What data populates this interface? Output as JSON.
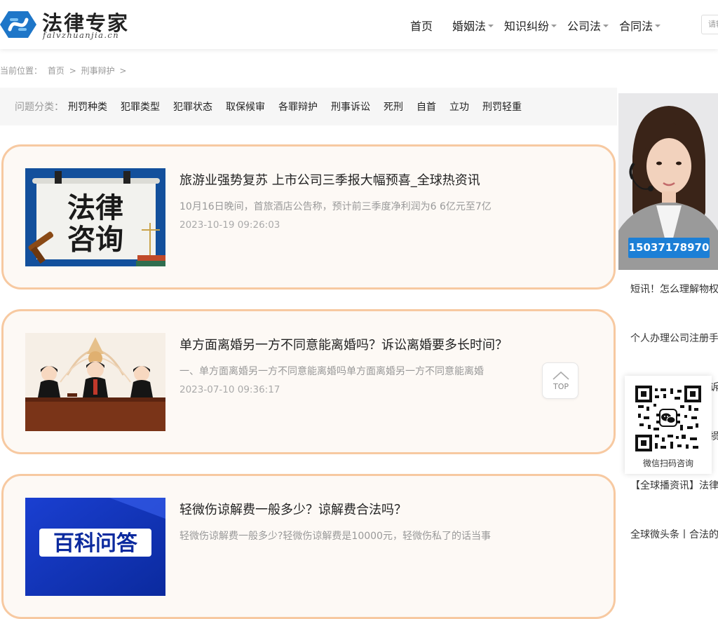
{
  "header": {
    "logo_title": "法律专家",
    "logo_sub": "falvzhuanjia.cn",
    "nav": [
      {
        "label": "首页",
        "has_dropdown": false
      },
      {
        "label": "婚姻法",
        "has_dropdown": true
      },
      {
        "label": "知识纠纷",
        "has_dropdown": true
      },
      {
        "label": "公司法",
        "has_dropdown": true
      },
      {
        "label": "合同法",
        "has_dropdown": true
      }
    ],
    "search_placeholder": "请输"
  },
  "breadcrumb": {
    "prefix": "当前位置：",
    "home": "首页",
    "sep": ">",
    "current": "刑事辩护"
  },
  "categories": {
    "label": "问题分类：",
    "items": [
      "刑罚种类",
      "犯罪类型",
      "犯罪状态",
      "取保候审",
      "各罪辩护",
      "刑事诉讼",
      "死刑",
      "自首",
      "立功",
      "刑罚轻重"
    ]
  },
  "articles": [
    {
      "title": "旅游业强势复苏 上市公司三季报大幅预喜_全球热资讯",
      "desc": "10月16日晚间，首旅酒店公告称，预计前三季度净利润为6 6亿元至7亿",
      "date": "2023-10-19 09:26:03",
      "image_text": [
        "法律",
        "咨询"
      ]
    },
    {
      "title": "单方面离婚另一方不同意能离婚吗？诉讼离婚要多长时间？",
      "desc": "一、单方面离婚另一方不同意能离婚吗单方面离婚另一方不同意能离婚",
      "date": "2023-07-10 09:36:17"
    },
    {
      "title": "轻微伤谅解费一般多少？谅解费合法吗？",
      "desc": "轻微伤谅解费一般多少?轻微伤谅解费是10000元，轻微伤私了的话当事",
      "date": "",
      "image_text": "百科问答"
    }
  ],
  "sidebar": {
    "phone": "15037178970",
    "links": [
      "短讯！怎么理解物权",
      "个人办理公司注册手",
      "诉",
      "损",
      "【全球播资讯】法律",
      "全球微头条丨合法的"
    ],
    "qr_label": "微信扫码咨询"
  },
  "top_button": {
    "label": "TOP"
  },
  "colors": {
    "card_border": "#f7c9a1",
    "card_bg": "#fdf9f5",
    "phone_badge": "#1c7fd6",
    "logo_blue": "#1e76c8"
  }
}
